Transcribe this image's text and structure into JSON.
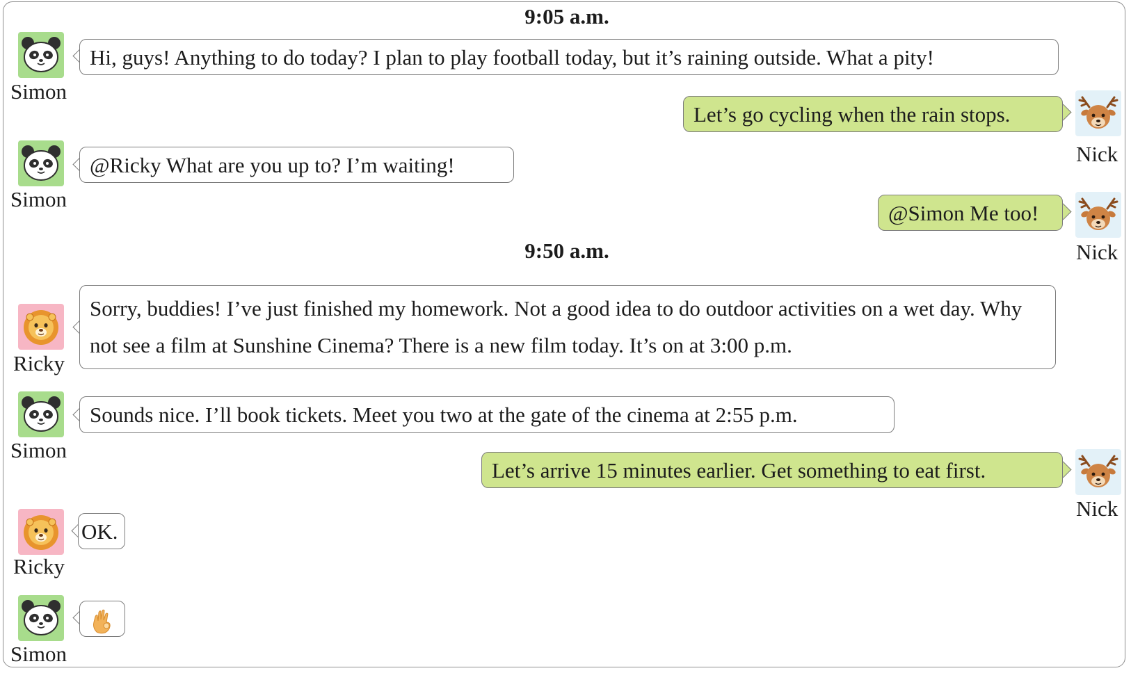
{
  "icons": {
    "simon": "panda-icon",
    "ricky": "lion-icon",
    "nick": "deer-icon",
    "ok_emoji": "ok-hand-icon"
  },
  "colors": {
    "own_bubble": "#cfe58e",
    "simon_avatar_bg": "#a8dc8c",
    "ricky_avatar_bg": "#f7b6c4",
    "nick_avatar_bg": "#e3f1f8",
    "border": "#8e8e8e"
  },
  "timestamps": [
    "9:05 a.m.",
    "9:50 a.m."
  ],
  "messages": [
    {
      "sender": "Simon",
      "text": "Hi, guys! Anything to do today? I plan to play football today, but it’s raining outside. What a pity!"
    },
    {
      "sender": "Nick",
      "text": "Let’s go cycling when the rain stops."
    },
    {
      "sender": "Simon",
      "text": "@Ricky What are you up to? I’m waiting!"
    },
    {
      "sender": "Nick",
      "text": "@Simon Me too!"
    },
    {
      "sender": "Ricky",
      "text": "Sorry, buddies! I’ve just finished my homework. Not a good idea to do outdoor activities on a wet day. Why not see a film at Sunshine Cinema? There is a new film today. It’s on at 3:00 p.m."
    },
    {
      "sender": "Simon",
      "text": "Sounds nice. I’ll book tickets. Meet you two at the gate of the cinema at 2:55 p.m."
    },
    {
      "sender": "Nick",
      "text": "Let’s arrive 15 minutes earlier. Get something to eat first."
    },
    {
      "sender": "Ricky",
      "text": "OK."
    },
    {
      "sender": "Simon",
      "text": ""
    }
  ]
}
